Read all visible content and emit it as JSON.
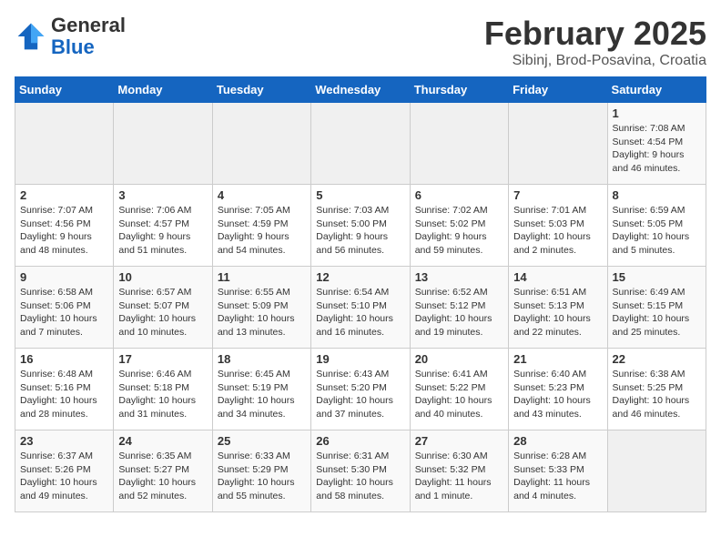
{
  "header": {
    "logo_general": "General",
    "logo_blue": "Blue",
    "title": "February 2025",
    "subtitle": "Sibinj, Brod-Posavina, Croatia"
  },
  "days_of_week": [
    "Sunday",
    "Monday",
    "Tuesday",
    "Wednesday",
    "Thursday",
    "Friday",
    "Saturday"
  ],
  "weeks": [
    [
      {
        "num": "",
        "info": ""
      },
      {
        "num": "",
        "info": ""
      },
      {
        "num": "",
        "info": ""
      },
      {
        "num": "",
        "info": ""
      },
      {
        "num": "",
        "info": ""
      },
      {
        "num": "",
        "info": ""
      },
      {
        "num": "1",
        "info": "Sunrise: 7:08 AM\nSunset: 4:54 PM\nDaylight: 9 hours and 46 minutes."
      }
    ],
    [
      {
        "num": "2",
        "info": "Sunrise: 7:07 AM\nSunset: 4:56 PM\nDaylight: 9 hours and 48 minutes."
      },
      {
        "num": "3",
        "info": "Sunrise: 7:06 AM\nSunset: 4:57 PM\nDaylight: 9 hours and 51 minutes."
      },
      {
        "num": "4",
        "info": "Sunrise: 7:05 AM\nSunset: 4:59 PM\nDaylight: 9 hours and 54 minutes."
      },
      {
        "num": "5",
        "info": "Sunrise: 7:03 AM\nSunset: 5:00 PM\nDaylight: 9 hours and 56 minutes."
      },
      {
        "num": "6",
        "info": "Sunrise: 7:02 AM\nSunset: 5:02 PM\nDaylight: 9 hours and 59 minutes."
      },
      {
        "num": "7",
        "info": "Sunrise: 7:01 AM\nSunset: 5:03 PM\nDaylight: 10 hours and 2 minutes."
      },
      {
        "num": "8",
        "info": "Sunrise: 6:59 AM\nSunset: 5:05 PM\nDaylight: 10 hours and 5 minutes."
      }
    ],
    [
      {
        "num": "9",
        "info": "Sunrise: 6:58 AM\nSunset: 5:06 PM\nDaylight: 10 hours and 7 minutes."
      },
      {
        "num": "10",
        "info": "Sunrise: 6:57 AM\nSunset: 5:07 PM\nDaylight: 10 hours and 10 minutes."
      },
      {
        "num": "11",
        "info": "Sunrise: 6:55 AM\nSunset: 5:09 PM\nDaylight: 10 hours and 13 minutes."
      },
      {
        "num": "12",
        "info": "Sunrise: 6:54 AM\nSunset: 5:10 PM\nDaylight: 10 hours and 16 minutes."
      },
      {
        "num": "13",
        "info": "Sunrise: 6:52 AM\nSunset: 5:12 PM\nDaylight: 10 hours and 19 minutes."
      },
      {
        "num": "14",
        "info": "Sunrise: 6:51 AM\nSunset: 5:13 PM\nDaylight: 10 hours and 22 minutes."
      },
      {
        "num": "15",
        "info": "Sunrise: 6:49 AM\nSunset: 5:15 PM\nDaylight: 10 hours and 25 minutes."
      }
    ],
    [
      {
        "num": "16",
        "info": "Sunrise: 6:48 AM\nSunset: 5:16 PM\nDaylight: 10 hours and 28 minutes."
      },
      {
        "num": "17",
        "info": "Sunrise: 6:46 AM\nSunset: 5:18 PM\nDaylight: 10 hours and 31 minutes."
      },
      {
        "num": "18",
        "info": "Sunrise: 6:45 AM\nSunset: 5:19 PM\nDaylight: 10 hours and 34 minutes."
      },
      {
        "num": "19",
        "info": "Sunrise: 6:43 AM\nSunset: 5:20 PM\nDaylight: 10 hours and 37 minutes."
      },
      {
        "num": "20",
        "info": "Sunrise: 6:41 AM\nSunset: 5:22 PM\nDaylight: 10 hours and 40 minutes."
      },
      {
        "num": "21",
        "info": "Sunrise: 6:40 AM\nSunset: 5:23 PM\nDaylight: 10 hours and 43 minutes."
      },
      {
        "num": "22",
        "info": "Sunrise: 6:38 AM\nSunset: 5:25 PM\nDaylight: 10 hours and 46 minutes."
      }
    ],
    [
      {
        "num": "23",
        "info": "Sunrise: 6:37 AM\nSunset: 5:26 PM\nDaylight: 10 hours and 49 minutes."
      },
      {
        "num": "24",
        "info": "Sunrise: 6:35 AM\nSunset: 5:27 PM\nDaylight: 10 hours and 52 minutes."
      },
      {
        "num": "25",
        "info": "Sunrise: 6:33 AM\nSunset: 5:29 PM\nDaylight: 10 hours and 55 minutes."
      },
      {
        "num": "26",
        "info": "Sunrise: 6:31 AM\nSunset: 5:30 PM\nDaylight: 10 hours and 58 minutes."
      },
      {
        "num": "27",
        "info": "Sunrise: 6:30 AM\nSunset: 5:32 PM\nDaylight: 11 hours and 1 minute."
      },
      {
        "num": "28",
        "info": "Sunrise: 6:28 AM\nSunset: 5:33 PM\nDaylight: 11 hours and 4 minutes."
      },
      {
        "num": "",
        "info": ""
      }
    ]
  ]
}
